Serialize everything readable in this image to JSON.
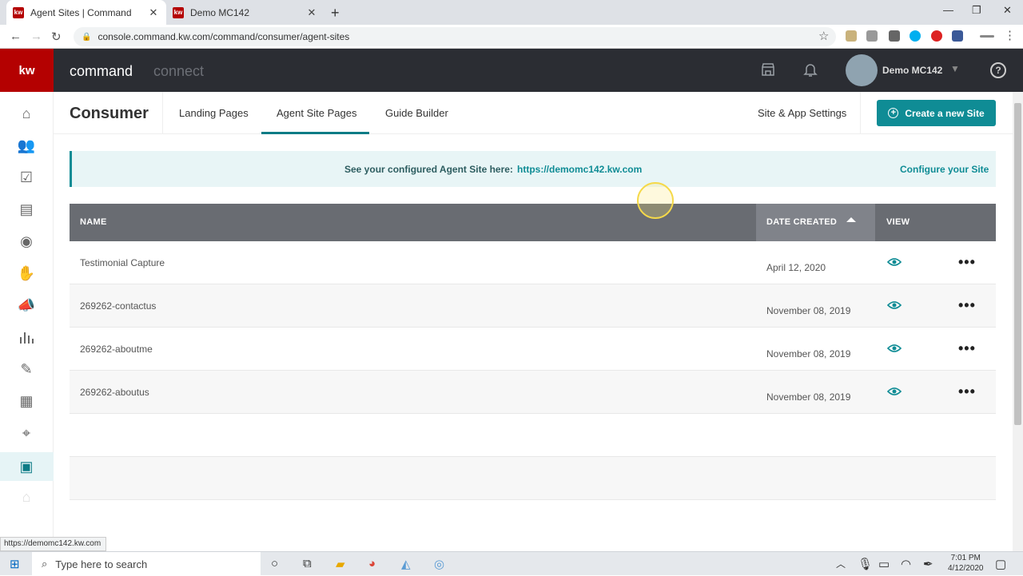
{
  "browser": {
    "tabs": [
      {
        "title": "Agent Sites | Command",
        "favicon": "kw-favicon",
        "active": true
      },
      {
        "title": "Demo MC142",
        "favicon": "kw-favicon",
        "active": false
      }
    ],
    "url": "console.command.kw.com/command/consumer/agent-sites",
    "status_url": "https://demomc142.kw.com"
  },
  "app": {
    "logo": "kw",
    "brand_primary": "command",
    "brand_secondary": "connect",
    "user_name": "Demo MC142",
    "help": "?"
  },
  "subnav": {
    "title": "Consumer",
    "tabs": [
      "Landing Pages",
      "Agent Site Pages",
      "Guide Builder"
    ],
    "active_tab": "Agent Site Pages",
    "settings": "Site & App Settings",
    "create_button": "Create a new Site"
  },
  "banner": {
    "label": "See your configured Agent Site here:",
    "link": "https://demomc142.kw.com",
    "configure": "Configure your Site"
  },
  "table": {
    "headers": {
      "name": "NAME",
      "date": "DATE CREATED",
      "view": "VIEW"
    },
    "rows": [
      {
        "name": "Testimonial Capture",
        "date": "April 12, 2020"
      },
      {
        "name": "269262-contactus",
        "date": "November 08, 2019"
      },
      {
        "name": "269262-aboutme",
        "date": "November 08, 2019"
      },
      {
        "name": "269262-aboutus",
        "date": "November 08, 2019"
      }
    ]
  },
  "taskbar": {
    "search_placeholder": "Type here to search",
    "time": "7:01 PM",
    "date": "4/12/2020"
  },
  "colors": {
    "brand_red": "#b40101",
    "teal": "#0f8c95",
    "header_dark": "#2b2d33",
    "table_header": "#696c72"
  }
}
